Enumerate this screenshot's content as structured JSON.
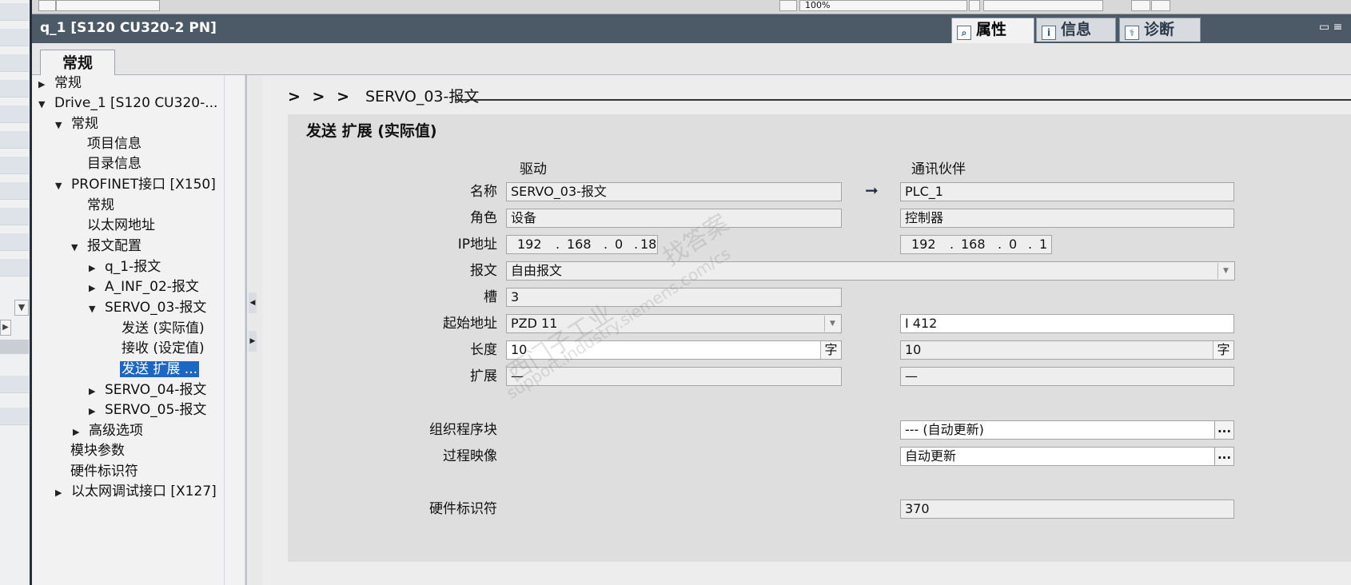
{
  "window_title": "q_1 [S120 CU320-2 PN]",
  "inspector_tabs": [
    {
      "label": "属性",
      "icon": "properties-icon"
    },
    {
      "label": "信息",
      "icon": "info-icon"
    },
    {
      "label": "诊断",
      "icon": "diagnostics-icon"
    }
  ],
  "top_remnant": {
    "zoom": "100%"
  },
  "tab": {
    "label": "常规"
  },
  "nav": {
    "items": [
      {
        "label": "常规",
        "state": "collapsed"
      },
      {
        "label": "Drive_1 [S120 CU320-...",
        "state": "expanded"
      },
      {
        "label": "常规",
        "state": "expanded"
      },
      {
        "label": "项目信息",
        "state": "leaf"
      },
      {
        "label": "目录信息",
        "state": "leaf"
      },
      {
        "label": "PROFINET接口 [X150]",
        "state": "expanded"
      },
      {
        "label": "常规",
        "state": "leaf"
      },
      {
        "label": "以太网地址",
        "state": "leaf"
      },
      {
        "label": "报文配置",
        "state": "expanded"
      },
      {
        "label": "q_1-报文",
        "state": "collapsed"
      },
      {
        "label": "A_INF_02-报文",
        "state": "collapsed"
      },
      {
        "label": "SERVO_03-报文",
        "state": "expanded"
      },
      {
        "label": "发送 (实际值)",
        "state": "leaf"
      },
      {
        "label": "接收 (设定值)",
        "state": "leaf"
      },
      {
        "label": "发送 扩展 ...",
        "state": "selected"
      },
      {
        "label": "SERVO_04-报文",
        "state": "collapsed"
      },
      {
        "label": "SERVO_05-报文",
        "state": "collapsed"
      },
      {
        "label": "高级选项",
        "state": "collapsed"
      },
      {
        "label": "模块参数",
        "state": "leaf"
      },
      {
        "label": "硬件标识符",
        "state": "leaf"
      },
      {
        "label": "以太网调试接口 [X127]",
        "state": "collapsed"
      }
    ]
  },
  "breadcrumb": {
    "chevrons": "> > >",
    "text": "SERVO_03-报文"
  },
  "panel": {
    "title": "发送 扩展 (实际值)",
    "col_drive": "驱动",
    "col_partner": "通讯伙伴",
    "labels": {
      "name": "名称",
      "role": "角色",
      "ip": "IP地址",
      "telegram": "报文",
      "slot": "槽",
      "start": "起始地址",
      "length": "长度",
      "extension": "扩展",
      "ob": "组织程序块",
      "process_image": "过程映像",
      "hw_id": "硬件标识符"
    },
    "drive": {
      "name": "SERVO_03-报文",
      "role": "设备",
      "ip": [
        "192",
        "168",
        "0",
        "18"
      ],
      "slot": "3",
      "start": "PZD 11",
      "length": "10",
      "length_unit": "字",
      "extension": "—"
    },
    "partner": {
      "name": "PLC_1",
      "role": "控制器",
      "ip": [
        "192",
        "168",
        "0",
        "1"
      ],
      "start": "I 412",
      "length": "10",
      "length_unit": "字",
      "extension": "—"
    },
    "telegram": "自由报文",
    "ob": "--- (自动更新)",
    "process_image": "自动更新",
    "hw_id": "370"
  },
  "watermark": {
    "text1": "西门子工业",
    "text2": "support.industry.siemens.com/cs",
    "text3": "找答案"
  }
}
